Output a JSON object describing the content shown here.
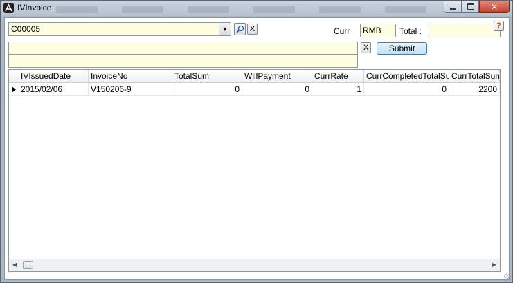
{
  "window": {
    "title": "IVInvoice"
  },
  "toolbar": {
    "customer_value": "C00005",
    "clear_label": "X",
    "curr_label": "Curr",
    "curr_value": "RMB",
    "total_label": "Total :",
    "total_value": "",
    "help_label": "?",
    "memo_clear_label": "X",
    "submit_label": "Submit"
  },
  "grid": {
    "columns": [
      "IVIssuedDate",
      "InvoiceNo",
      "TotalSum",
      "WillPayment",
      "CurrRate",
      "CurrCompletedTotalSum",
      "CurrTotalSum"
    ],
    "rows": [
      [
        "2015/02/06",
        "V150206-9",
        "0",
        "0",
        "1",
        "0",
        "2200"
      ]
    ]
  },
  "colors": {
    "field_background": "#fffee0",
    "window_frame": "#aeb9c6",
    "close_button": "#c2402c"
  },
  "icons": {
    "combo_arrow": "chevron-down-icon",
    "search": "search-icon",
    "row_indicator": "triangle-right-icon"
  }
}
